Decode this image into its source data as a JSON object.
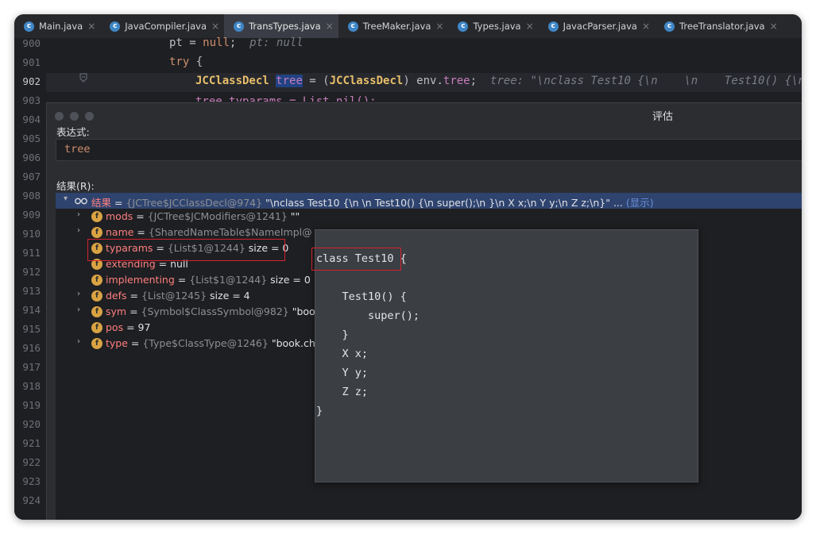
{
  "tabs": [
    {
      "label": "Main.java"
    },
    {
      "label": "JavaCompiler.java"
    },
    {
      "label": "TransTypes.java"
    },
    {
      "label": "TreeMaker.java"
    },
    {
      "label": "Types.java"
    },
    {
      "label": "JavacParser.java"
    },
    {
      "label": "TreeTranslator.java"
    }
  ],
  "tab_close": "×",
  "class_icon": "c",
  "line_numbers": [
    "900",
    "901",
    "902",
    "903",
    "904",
    "905",
    "906",
    "907",
    "908",
    "909",
    "910",
    "911",
    "912",
    "913",
    "914",
    "915",
    "916",
    "917",
    "918",
    "919",
    "920",
    "921",
    "922",
    "923",
    "924"
  ],
  "code": {
    "l900_a": "pt = ",
    "l900_kw": "null",
    "l900_b": ";  ",
    "l900_hint": "pt: null",
    "l901_kw": "try",
    "l901_b": " {",
    "l902_type": "JCClassDecl",
    "l902_var": "tree",
    "l902_b": " = (",
    "l902_cast": "JCClassDecl",
    "l902_c": ") env.",
    "l902_fld": "tree",
    "l902_d": ";  ",
    "l902_hint": "tree: \"\\nclass Test10 {\\n    \\n    Test10() {\\n",
    "l903": "tree.typarams = List.nil();"
  },
  "dialog": {
    "title": "评估",
    "expression_label": "表达式:",
    "expression_value": "tree",
    "result_label": "结果(R):"
  },
  "result_row": {
    "name": "结果",
    "eq": " = ",
    "ref": "{JCTree$JCClassDecl@974}",
    "value_prefix": " \"",
    "value_body": "\\nclass Test10 {\\n    \\n    Test10() {\\n        super();\\n    }\\n    X x;\\n    Y y;\\n    Z z;\\n}",
    "value_suffix": "\" ... ",
    "show_link": "(显示)"
  },
  "fields": [
    {
      "name": "mods",
      "ref": "{JCTree$JCModifiers@1241}",
      "value": " \"\"",
      "expandable": true
    },
    {
      "name": "name",
      "ref": "{SharedNameTable$NameImpl@",
      "value": "",
      "expandable": true
    },
    {
      "name": "typarams",
      "ref": "{List$1@1244}",
      "value": "  size = 0",
      "expandable": false
    },
    {
      "name": "extending",
      "ref": "",
      "value": "null",
      "expandable": false
    },
    {
      "name": "implementing",
      "ref": "{List$1@1244}",
      "value": "  size = 0",
      "expandable": false
    },
    {
      "name": "defs",
      "ref": "{List@1245}",
      "value": "  size = 4",
      "expandable": true
    },
    {
      "name": "sym",
      "ref": "{Symbol$ClassSymbol@982}",
      "value": " \"boo",
      "expandable": true
    },
    {
      "name": "pos",
      "ref": "",
      "value": "97",
      "expandable": false
    },
    {
      "name": "type",
      "ref": "{Type$ClassType@1246}",
      "value": " \"book.ch",
      "expandable": true
    }
  ],
  "field_icon": "f",
  "popup_text": "class Test10 {\n\n    Test10() {\n        super();\n    }\n    X x;\n    Y y;\n    Z z;\n}",
  "colors": {
    "accent": "#3f86c6",
    "field_icon": "#d9a343",
    "highlight_box": "#d4212f"
  }
}
